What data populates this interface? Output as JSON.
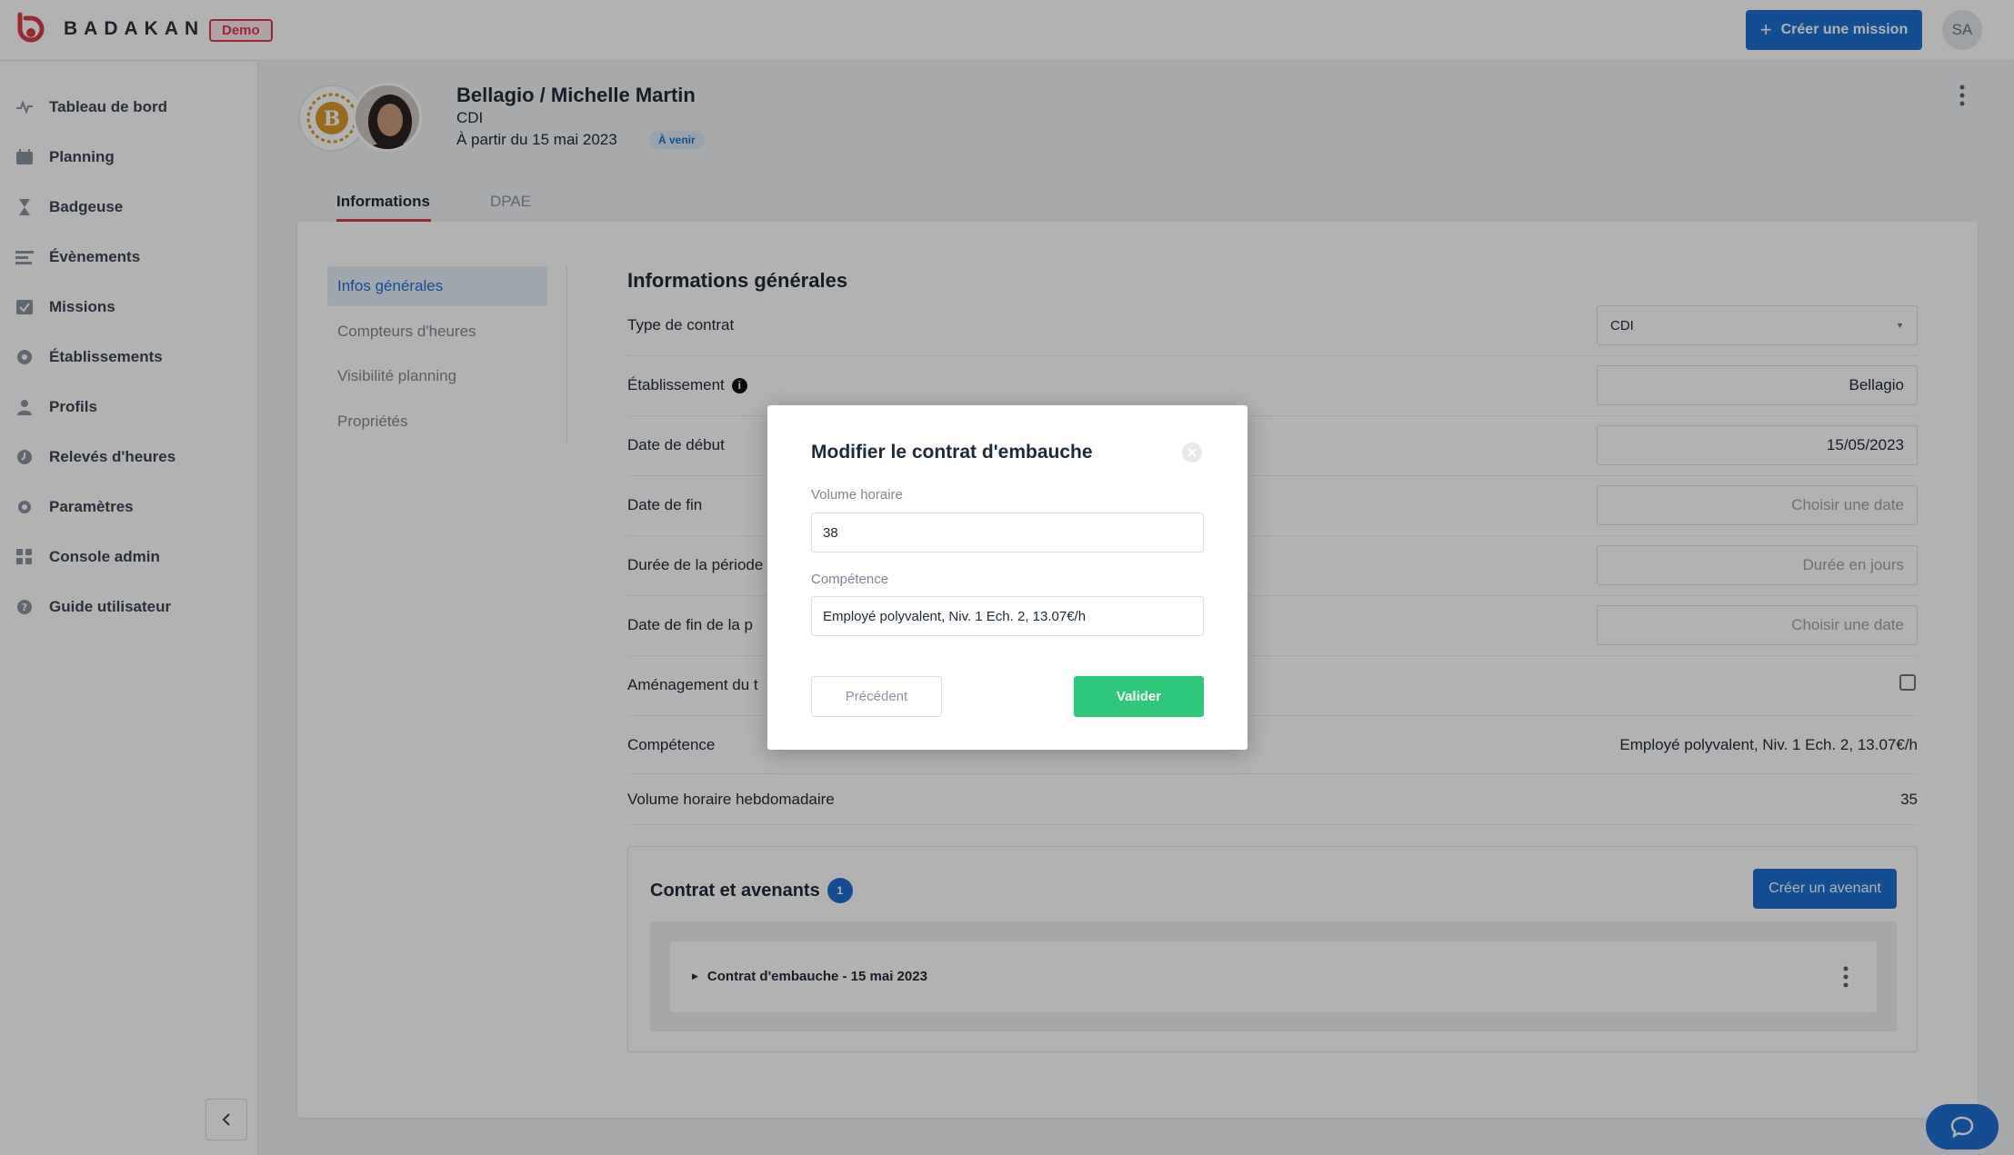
{
  "topbar": {
    "brand": "BADAKAN",
    "demo_badge": "Demo",
    "create_mission": "Créer une mission",
    "avatar_initials": "SA"
  },
  "sidebar": {
    "items": [
      {
        "label": "Tableau de bord",
        "icon": "dashboard-icon"
      },
      {
        "label": "Planning",
        "icon": "calendar-icon"
      },
      {
        "label": "Badgeuse",
        "icon": "hourglass-icon"
      },
      {
        "label": "Évènements",
        "icon": "list-icon"
      },
      {
        "label": "Missions",
        "icon": "checklist-icon"
      },
      {
        "label": "Établissements",
        "icon": "building-icon"
      },
      {
        "label": "Profils",
        "icon": "user-icon"
      },
      {
        "label": "Relevés d'heures",
        "icon": "clock-icon"
      },
      {
        "label": "Paramètres",
        "icon": "gear-icon"
      },
      {
        "label": "Console admin",
        "icon": "grid-icon"
      },
      {
        "label": "Guide utilisateur",
        "icon": "help-icon"
      }
    ]
  },
  "profile": {
    "name": "Bellagio / Michelle Martin",
    "contract": "CDI",
    "start": "À partir du 15 mai 2023",
    "status": "À venir"
  },
  "tabs": {
    "informations": "Informations",
    "dpae": "DPAE"
  },
  "subnav": {
    "items": [
      "Infos générales",
      "Compteurs d'heures",
      "Visibilité planning",
      "Propriétés"
    ]
  },
  "general": {
    "title": "Informations générales",
    "contract_type_label": "Type de contrat",
    "contract_type_value": "CDI",
    "establishment_label": "Établissement",
    "establishment_value": "Bellagio",
    "start_label": "Date de début",
    "start_value": "15/05/2023",
    "end_label": "Date de fin",
    "end_placeholder": "Choisir une date",
    "trial_label": "Durée de la période",
    "trial_placeholder": "Durée en jours",
    "trial_end_label": "Date de fin de la p",
    "trial_end_placeholder": "Choisir une date",
    "arrangement_label": "Aménagement du t",
    "skill_label": "Compétence",
    "skill_value": "Employé polyvalent, Niv. 1 Ech. 2, 13.07€/h",
    "weekly_label": "Volume horaire hebdomadaire",
    "weekly_value": "35"
  },
  "contracts": {
    "title": "Contrat et avenants",
    "count": "1",
    "create_button": "Créer un avenant",
    "item_label": "Contrat d'embauche - 15 mai 2023"
  },
  "modal": {
    "title": "Modifier le contrat d'embauche",
    "volume_label": "Volume horaire",
    "volume_value": "38",
    "skill_label": "Compétence",
    "skill_value": "Employé polyvalent, Niv. 1 Ech. 2, 13.07€/h",
    "prev_button": "Précédent",
    "validate_button": "Valider"
  },
  "colors": {
    "primary": "#1f6fd1",
    "success": "#2fc77a",
    "danger": "#d83b4a"
  }
}
